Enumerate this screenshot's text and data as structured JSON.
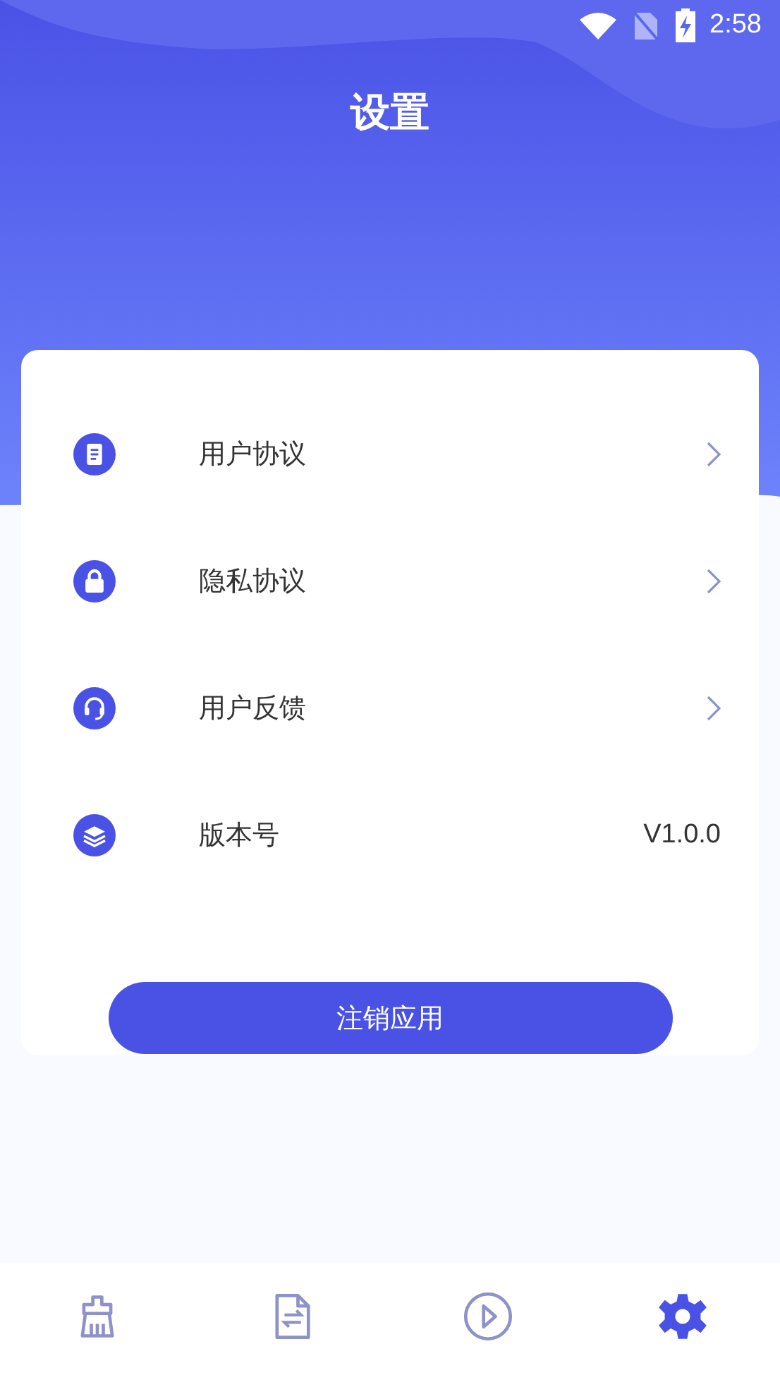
{
  "status_bar": {
    "time": "2:58"
  },
  "title": "设置",
  "items": [
    {
      "label": "用户协议",
      "kind": "link"
    },
    {
      "label": "隐私协议",
      "kind": "link"
    },
    {
      "label": "用户反馈",
      "kind": "link"
    },
    {
      "label": "版本号",
      "kind": "value",
      "value": "V1.0.0"
    }
  ],
  "button": {
    "label": "注销应用"
  },
  "nav": [
    {
      "selected": false
    },
    {
      "selected": false
    },
    {
      "selected": false
    },
    {
      "selected": true
    }
  ]
}
